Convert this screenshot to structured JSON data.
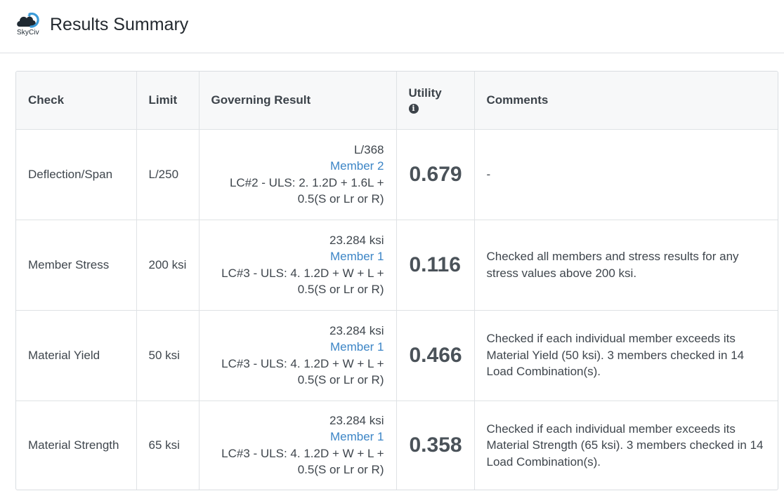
{
  "app": {
    "logo_text": "SkyCiv",
    "title": "Results Summary"
  },
  "table": {
    "headers": {
      "check": "Check",
      "limit": "Limit",
      "governing": "Governing Result",
      "utility": "Utility",
      "comments": "Comments"
    },
    "rows": [
      {
        "check": "Deflection/Span",
        "limit": "L/250",
        "result_value": "L/368",
        "member": "Member 2",
        "load_case_1": "LC#2 - ULS: 2. 1.2D + 1.6L +",
        "load_case_2": "0.5(S or Lr or R)",
        "utility": "0.679",
        "comment": "-"
      },
      {
        "check": "Member Stress",
        "limit": "200 ksi",
        "result_value": "23.284 ksi",
        "member": "Member 1",
        "load_case_1": "LC#3 - ULS: 4. 1.2D + W + L +",
        "load_case_2": "0.5(S or Lr or R)",
        "utility": "0.116",
        "comment": "Checked all members and stress results for any stress values above 200 ksi."
      },
      {
        "check": "Material Yield",
        "limit": "50 ksi",
        "result_value": "23.284 ksi",
        "member": "Member 1",
        "load_case_1": "LC#3 - ULS: 4. 1.2D + W + L +",
        "load_case_2": "0.5(S or Lr or R)",
        "utility": "0.466",
        "comment": "Checked if each individual member exceeds its Material Yield (50 ksi). 3 members checked in 14 Load Combination(s)."
      },
      {
        "check": "Material Strength",
        "limit": "65 ksi",
        "result_value": "23.284 ksi",
        "member": "Member 1",
        "load_case_1": "LC#3 - ULS: 4. 1.2D + W + L +",
        "load_case_2": "0.5(S or Lr or R)",
        "utility": "0.358",
        "comment": "Checked if each individual member exceeds its Material Strength (65 ksi). 3 members checked in 14 Load Combination(s)."
      }
    ]
  },
  "colors": {
    "link": "#3c85c6",
    "header_bg": "#f7f8f9",
    "border": "#dfe2e5"
  }
}
